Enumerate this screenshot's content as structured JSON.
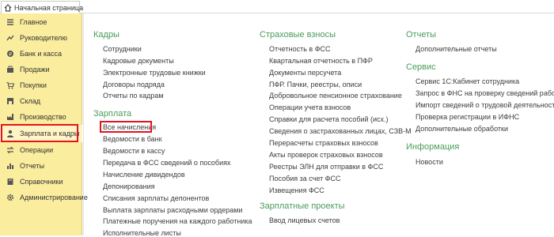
{
  "tabs": {
    "home_label": "Начальная страница"
  },
  "sidebar": {
    "items": [
      {
        "label": "Главное",
        "icon": "menu-icon"
      },
      {
        "label": "Руководителю",
        "icon": "trend-icon"
      },
      {
        "label": "Банк и касса",
        "icon": "bank-icon"
      },
      {
        "label": "Продажи",
        "icon": "sales-icon"
      },
      {
        "label": "Покупки",
        "icon": "cart-icon"
      },
      {
        "label": "Склад",
        "icon": "warehouse-icon"
      },
      {
        "label": "Производство",
        "icon": "production-icon"
      },
      {
        "label": "Зарплата и кадры",
        "icon": "person-icon"
      },
      {
        "label": "Операции",
        "icon": "operations-icon"
      },
      {
        "label": "Отчеты",
        "icon": "reports-icon"
      },
      {
        "label": "Справочники",
        "icon": "book-icon"
      },
      {
        "label": "Администрирование",
        "icon": "gear-icon"
      }
    ],
    "highlight_color": "#e0141e",
    "background": "#fbed9e"
  },
  "sections": {
    "kadry": {
      "title": "Кадры",
      "links": [
        "Сотрудники",
        "Кадровые документы",
        "Электронные трудовые книжки",
        "Договоры подряда",
        "Отчеты по кадрам"
      ]
    },
    "zarplata": {
      "title": "Зарплата",
      "links": [
        "Все начисления",
        "Ведомости в банк",
        "Ведомости в кассу",
        "Передача в ФСС сведений о пособиях",
        "Начисление дивидендов",
        "Депонирования",
        "Списания зарплаты депонентов",
        "Выплата зарплаты расходными ордерами",
        "Платежные поручения на каждого работника",
        "Исполнительные листы"
      ]
    },
    "strahovye": {
      "title": "Страховые взносы",
      "links": [
        "Отчетность в ФСС",
        "Квартальная отчетность в ПФР",
        "Документы персучета",
        "ПФР. Пачки, реестры, описи",
        "Добровольное пенсионное страхование",
        "Операции учета взносов",
        "Справки для расчета пособий (исх.)",
        "Сведения о застрахованных лицах, СЗВ-М",
        "Перерасчеты страховых взносов",
        "Акты проверок страховых взносов",
        "Реестры ЭЛН для отправки в ФСС",
        "Пособия за счет ФСС",
        "Извещения ФСС"
      ]
    },
    "proekty": {
      "title": "Зарплатные проекты",
      "links": [
        "Ввод лицевых счетов"
      ]
    },
    "otchety": {
      "title": "Отчеты",
      "links": [
        "Дополнительные отчеты"
      ]
    },
    "servis": {
      "title": "Сервис",
      "links": [
        "Сервис 1С:Кабинет сотрудника",
        "Запрос в ФНС на проверку сведений работников",
        "Импорт сведений о трудовой деятельности",
        "Проверка регистрации в ИФНС",
        "Дополнительные обработки"
      ]
    },
    "info": {
      "title": "Информация",
      "links": [
        "Новости"
      ]
    }
  },
  "colors": {
    "section_title": "#4b9b5b",
    "link": "#3c3c3c"
  }
}
